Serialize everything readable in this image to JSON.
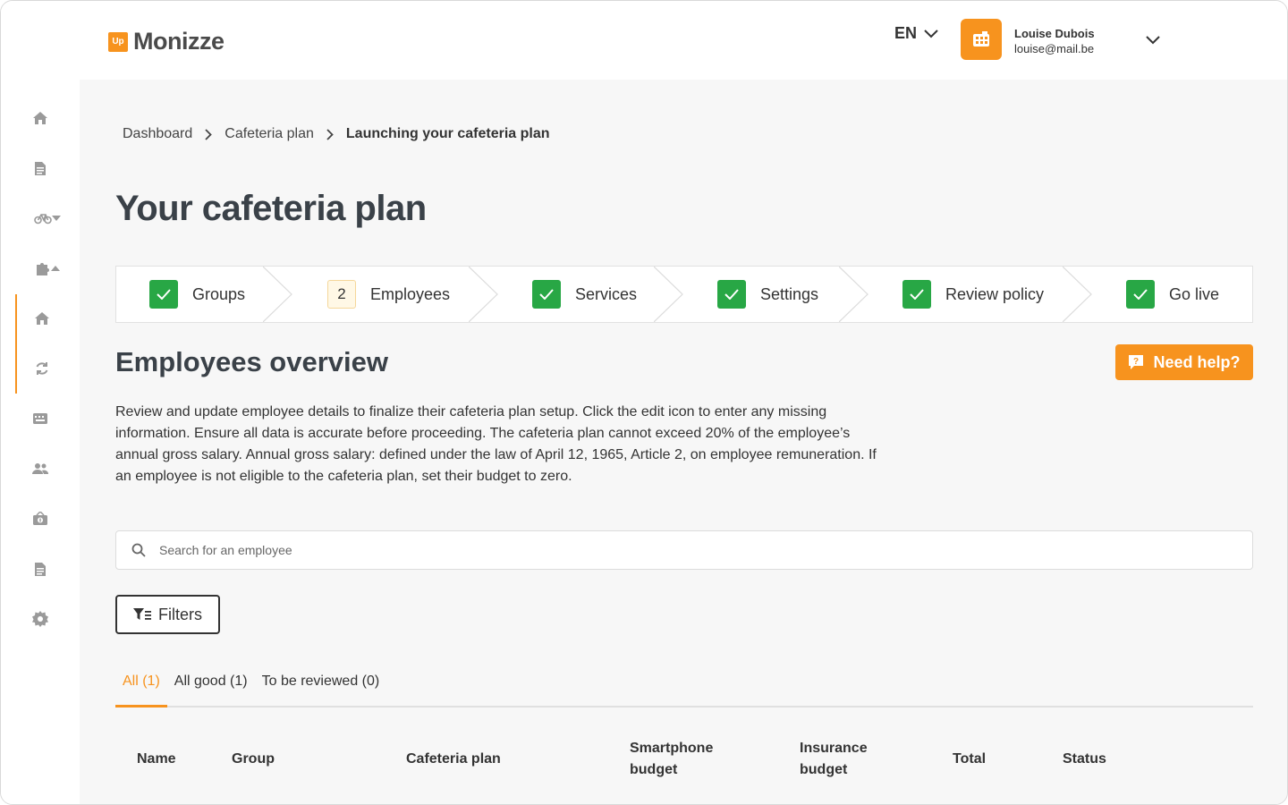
{
  "brand": {
    "logo_badge": "Up",
    "name": "Monizze",
    "accent": "#f7931e"
  },
  "header": {
    "language": "EN",
    "user_name": "Louise Dubois",
    "user_email": "louise@mail.be"
  },
  "sidebar": {
    "items": [
      {
        "icon": "home-icon"
      },
      {
        "icon": "document-icon"
      },
      {
        "icon": "bike-icon"
      },
      {
        "icon": "puzzle-icon"
      },
      {
        "icon": "home-icon"
      },
      {
        "icon": "refresh-icon"
      },
      {
        "icon": "keyboard-icon"
      },
      {
        "icon": "users-icon"
      },
      {
        "icon": "money-box-icon"
      },
      {
        "icon": "document-icon"
      },
      {
        "icon": "gear-icon"
      }
    ]
  },
  "breadcrumb": {
    "items": [
      "Dashboard",
      "Cafeteria plan"
    ],
    "current": "Launching your cafeteria plan"
  },
  "page": {
    "title": "Your cafeteria plan"
  },
  "stepper": {
    "steps": [
      {
        "label": "Groups",
        "state": "done"
      },
      {
        "label": "Employees",
        "state": "current",
        "number": "2"
      },
      {
        "label": "Services",
        "state": "done"
      },
      {
        "label": "Settings",
        "state": "done"
      },
      {
        "label": "Review policy",
        "state": "done"
      },
      {
        "label": "Go live",
        "state": "done"
      }
    ]
  },
  "section": {
    "title": "Employees overview",
    "help_label": "Need help?",
    "description": "Review and update employee details to finalize their cafeteria plan setup. Click the edit icon to enter any missing information. Ensure all data is accurate before proceeding. The cafeteria plan cannot exceed 20% of the employee’s annual gross salary. Annual gross salary: defined under the law of April 12, 1965, Article 2, on employee remuneration. If an employee is not eligible to the cafeteria plan, set their budget to zero."
  },
  "search": {
    "placeholder": "Search for an employee",
    "value": ""
  },
  "filters": {
    "label": "Filters"
  },
  "tabs": [
    {
      "label": "All (1)",
      "active": true
    },
    {
      "label": "All good (1)",
      "active": false
    },
    {
      "label": "To be reviewed (0)",
      "active": false
    }
  ],
  "table": {
    "headers": {
      "name": "Name",
      "group": "Group",
      "cafeteria_plan": "Cafeteria plan",
      "smartphone_1": "Smartphone",
      "smartphone_2": "budget",
      "insurance_1": "Insurance",
      "insurance_2": "budget",
      "total": "Total",
      "status": "Status"
    }
  }
}
